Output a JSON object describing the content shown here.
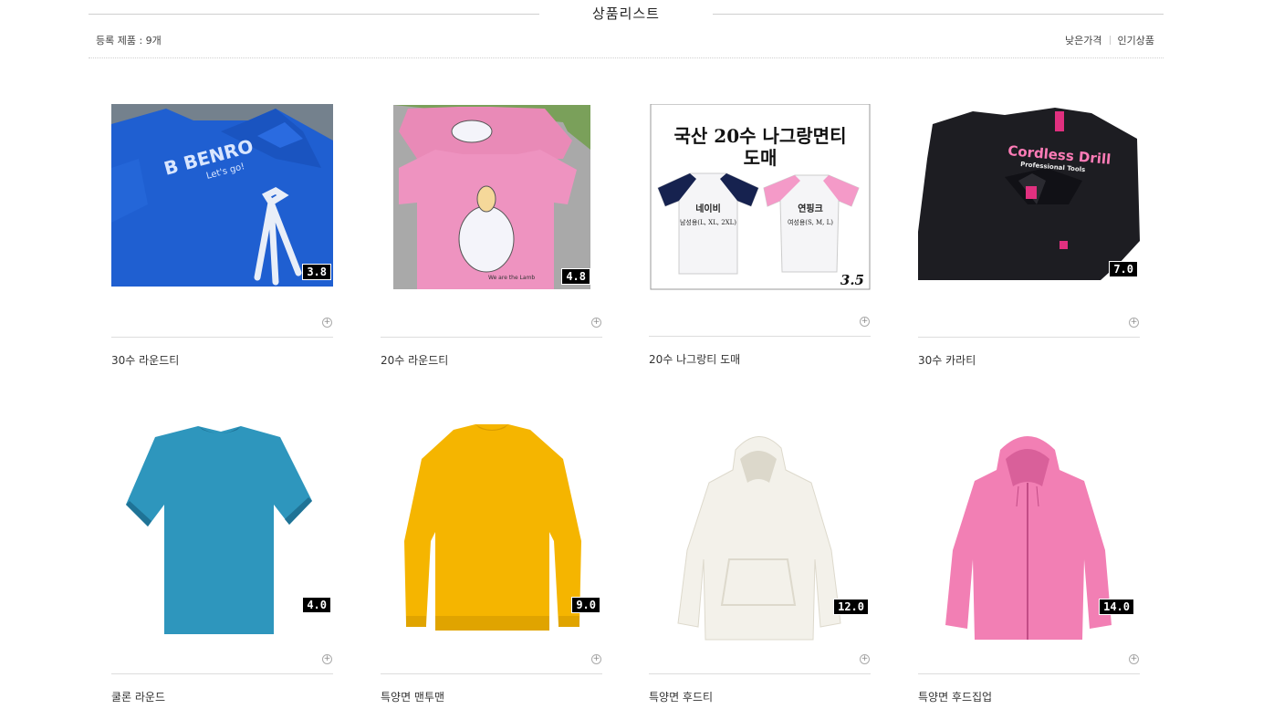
{
  "header": {
    "title": "상품리스트",
    "count_label": "등록 제품 : 9개",
    "sort_low_price": "낮은가격",
    "sort_popular": "인기상품"
  },
  "colors": {
    "line": "#cfcfcf",
    "text": "#333333"
  },
  "products": [
    {
      "name": "30수 라운드티",
      "badge": "3.8",
      "image": "blue-benro-tshirt"
    },
    {
      "name": "20수 라운드티",
      "badge": "4.8",
      "image": "pink-lamb-tshirts"
    },
    {
      "name": "20수 나그랑티 도매",
      "badge": "3.5",
      "image": "raglan-tshirt-ad",
      "image_text": {
        "headline1": "국산 20수 나그랑면티",
        "headline2": "도매",
        "navy_label": "네이비",
        "navy_sizes": "남성용(L, XL, 2XL)",
        "pink_label": "연핑크",
        "pink_sizes": "여성용(S, M, L)"
      }
    },
    {
      "name": "30수 카라티",
      "badge": "7.0",
      "image": "black-cordless-drill-polo",
      "image_text": {
        "line1": "Cordless Drill",
        "line2": "Professional Tools"
      }
    },
    {
      "name": "쿨론 라운드",
      "badge": "4.0",
      "image": "teal-tshirt"
    },
    {
      "name": "특양면 맨투맨",
      "badge": "9.0",
      "image": "yellow-sweatshirt"
    },
    {
      "name": "특양면 후드티",
      "badge": "12.0",
      "image": "white-hoodie"
    },
    {
      "name": "특양면 후드집업",
      "badge": "14.0",
      "image": "pink-zip-hoodie"
    }
  ]
}
